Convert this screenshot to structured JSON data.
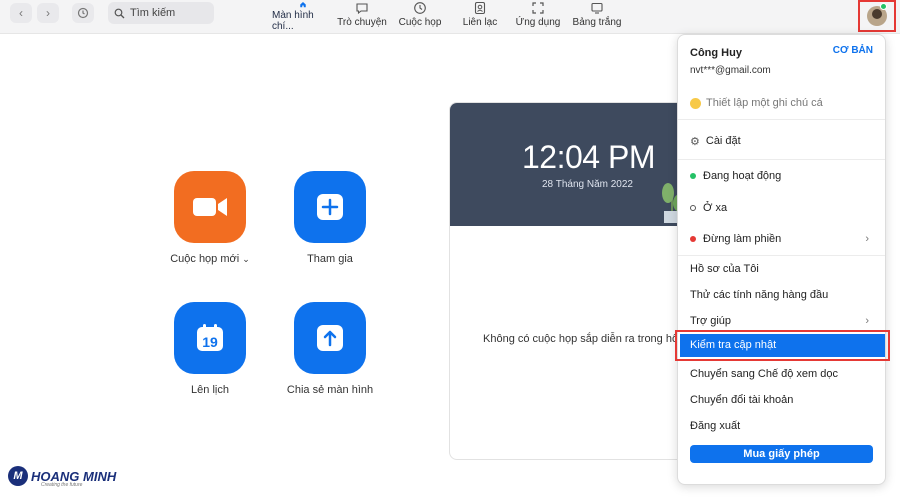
{
  "toolbar": {
    "search_placeholder": "Tìm kiếm",
    "tabs": [
      {
        "label": "Màn hình chí..."
      },
      {
        "label": "Trò chuyện"
      },
      {
        "label": "Cuộc họp"
      },
      {
        "label": "Liên lạc"
      },
      {
        "label": "Ứng dụng"
      },
      {
        "label": "Bảng trắng"
      }
    ]
  },
  "home": {
    "new_meeting": "Cuộc họp mới",
    "join": "Tham gia",
    "schedule": "Lên lịch",
    "share_screen": "Chia sẻ màn hình",
    "calendar_day": "19"
  },
  "meeting_panel": {
    "time": "12:04 PM",
    "date": "28 Tháng Năm 2022",
    "empty": "Không có cuộc họp sắp diễn ra trong hôm"
  },
  "profile_menu": {
    "name": "Công Huy",
    "plan": "CƠ BẢN",
    "email": "nvt***@gmail.com",
    "note": "Thiết lập một ghi chú cá",
    "settings": "Cài đặt",
    "status_active": "Đang hoạt động",
    "status_away": "Ở xa",
    "status_dnd": "Đừng làm phiền",
    "my_profile": "Hồ sơ của Tôi",
    "try_features": "Thử các tính năng hàng đầu",
    "help": "Trợ giúp",
    "check_updates": "Kiểm tra cập nhật",
    "portrait_view": "Chuyển sang Chế độ xem dọc",
    "switch_account": "Chuyển đổi tài khoản",
    "sign_out": "Đăng xuất",
    "buy_license": "Mua giấy phép"
  },
  "logo": {
    "mark": "M",
    "name": "HOANG MINH",
    "tagline": "Creating the future"
  },
  "colors": {
    "accent": "#0e72ed",
    "orange": "#f26d21",
    "highlight_border": "#e53935",
    "status_green": "#25c166",
    "status_red": "#e53935"
  }
}
